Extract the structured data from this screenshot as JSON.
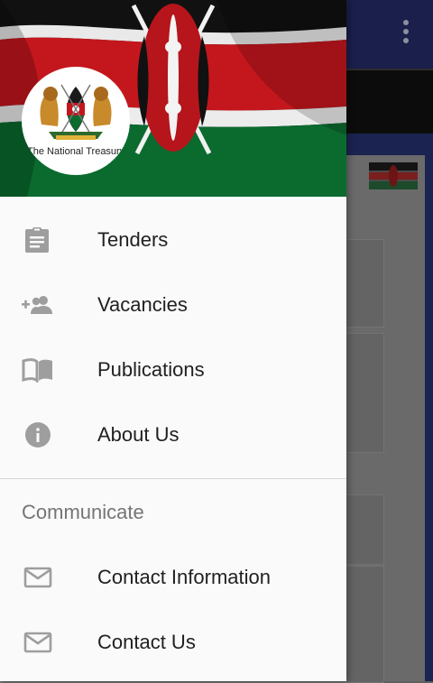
{
  "drawer": {
    "logo_caption": "The National Treasury",
    "menu": [
      {
        "label": "Tenders",
        "icon": "clipboard-icon"
      },
      {
        "label": "Vacancies",
        "icon": "group-add-icon"
      },
      {
        "label": "Publications",
        "icon": "book-icon"
      },
      {
        "label": "About Us",
        "icon": "info-icon"
      }
    ],
    "section_title": "Communicate",
    "communicate": [
      {
        "label": "Contact Information",
        "icon": "mail-icon"
      },
      {
        "label": "Contact Us",
        "icon": "mail-icon"
      }
    ]
  },
  "colors": {
    "flag_black": "#111111",
    "flag_red": "#c4171d",
    "flag_green": "#0b6b2f",
    "toolbar": "#1a1f4c",
    "icon_gray": "#9e9e9e"
  }
}
